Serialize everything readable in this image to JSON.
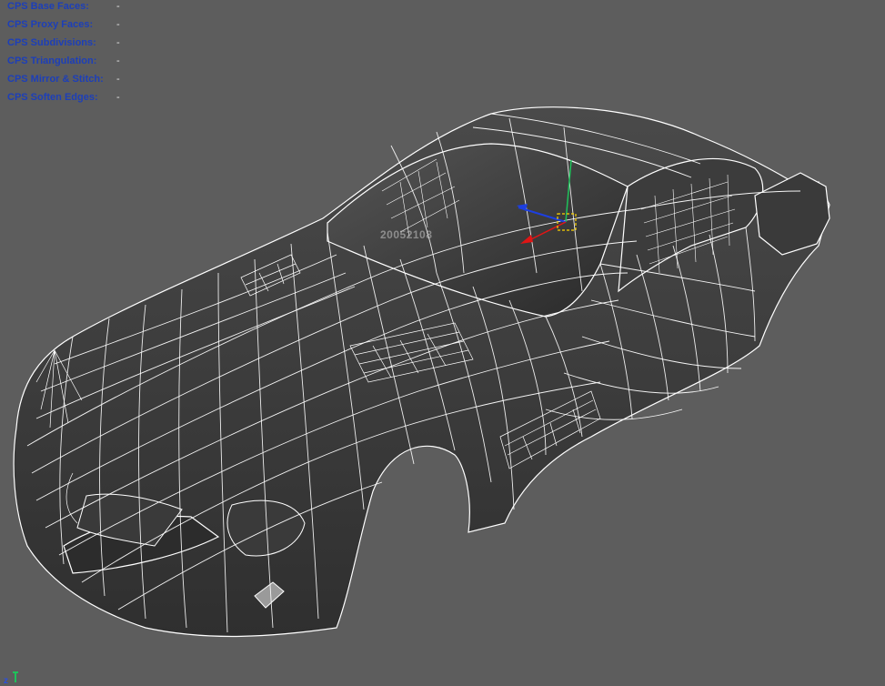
{
  "hud": {
    "rows": [
      {
        "label": "CPS Base Faces:",
        "value": "-"
      },
      {
        "label": "CPS Proxy Faces:",
        "value": "-"
      },
      {
        "label": "CPS Subdivisions:",
        "value": "-"
      },
      {
        "label": "CPS Triangulation:",
        "value": "-"
      },
      {
        "label": "CPS Mirror & Stitch:",
        "value": "-"
      },
      {
        "label": "CPS Soften Edges:",
        "value": "-"
      }
    ]
  },
  "watermark": "20052108",
  "axis": {
    "z_label": "z"
  },
  "colors": {
    "background": "#5d5d5d",
    "hud_label": "#1d3fb8",
    "wire": "#ffffff",
    "shell": "#3a3a3a",
    "gizmo_x": "#e01515",
    "gizmo_y": "#1ec25a",
    "gizmo_z": "#1d3fe0",
    "gizmo_box": "#ffd400"
  }
}
